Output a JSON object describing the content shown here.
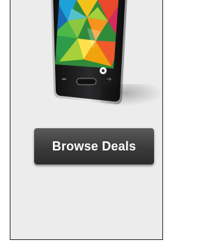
{
  "promo": {
    "product_image_icon": "smartphone-icon",
    "cta_label": "Browse Deals"
  },
  "colors": {
    "panel_background": "#ececec",
    "panel_border": "#2b2b2b",
    "button_background": "#3a3a3a",
    "button_text": "#ffffff"
  }
}
